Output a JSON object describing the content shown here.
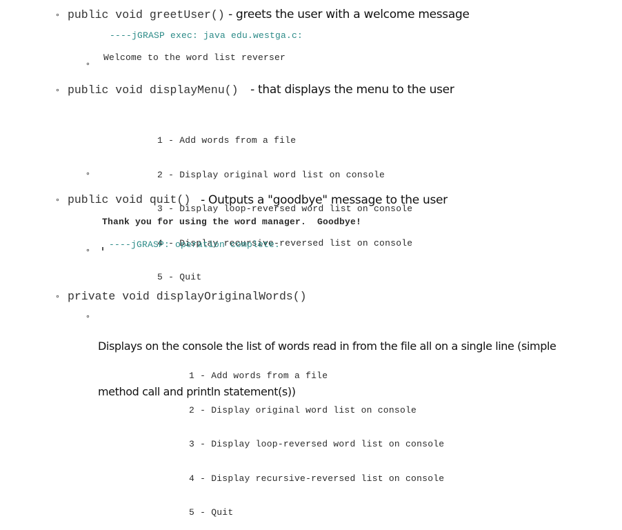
{
  "items": [
    {
      "signature": "public void greetUser()",
      "description": " - greets the user with a welcome message",
      "console": {
        "exec_line": "----jGRASP exec: java edu.westga.c:",
        "output": "Welcome to the word list reverser"
      }
    },
    {
      "signature": "public void displayMenu()",
      "description": " - that displays the menu to the user",
      "menu": [
        "1 - Add words from a file",
        "2 - Display original word list on console",
        "3 - Display loop-reversed word list on console",
        "4 - Display recursive-reversed list on console",
        "5 - Quit"
      ]
    },
    {
      "signature": "public void quit()",
      "description": " - Outputs a \"goodbye\" message to the user",
      "console": {
        "output": "Thank you for using the word manager.  Goodbye!",
        "complete_line": "----jGRASP: operation complete."
      }
    },
    {
      "signature": "private void displayOriginalWords()",
      "sub_bullet": "Displays on the console the list of words read in from the file all on a single line (simple method call and println statement(s))",
      "sub_bullet_lines": [
        "Displays on the console the list of words read in from the file all on a single line (simple",
        "method call and println statement(s))"
      ],
      "menu": [
        "1 - Add words from a file",
        "2 - Display original word list on console",
        "3 - Display loop-reversed word list on console",
        "4 - Display recursive-reversed list on console",
        "5 - Quit"
      ]
    }
  ],
  "bullet_glyph": "∘"
}
